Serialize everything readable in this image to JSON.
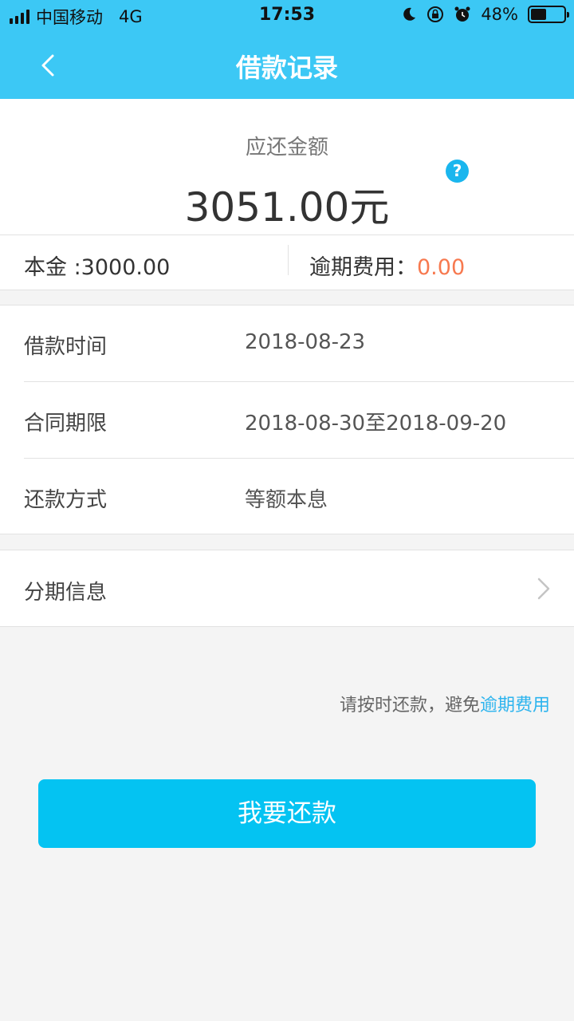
{
  "status_bar": {
    "carrier": "中国移动",
    "network": "4G",
    "time": "17:53",
    "battery": "48%",
    "battery_level": 0.48
  },
  "nav": {
    "title": "借款记录",
    "back_icon": "chevron-left-icon"
  },
  "summary": {
    "amount_label": "应还金额",
    "amount_value": "3051.00元",
    "help_icon": "?",
    "principal": "本金 :3000.00",
    "overdue_label": "逾期费用：",
    "overdue_value": "0.00"
  },
  "details": [
    {
      "label": "借款时间",
      "value": "2018-08-23"
    },
    {
      "label": "合同期限",
      "value": "2018-08-30至2018-09-20"
    },
    {
      "label": "还款方式",
      "value": "等额本息"
    }
  ],
  "installment": {
    "label": "分期信息"
  },
  "notice": {
    "text": "请按时还款，避免",
    "link": "逾期费用"
  },
  "actions": {
    "repay_label": "我要还款"
  },
  "colors": {
    "header": "#3cc8f5",
    "button": "#04c3f2",
    "overdue": "#f7794f",
    "link": "#2db4ee"
  }
}
